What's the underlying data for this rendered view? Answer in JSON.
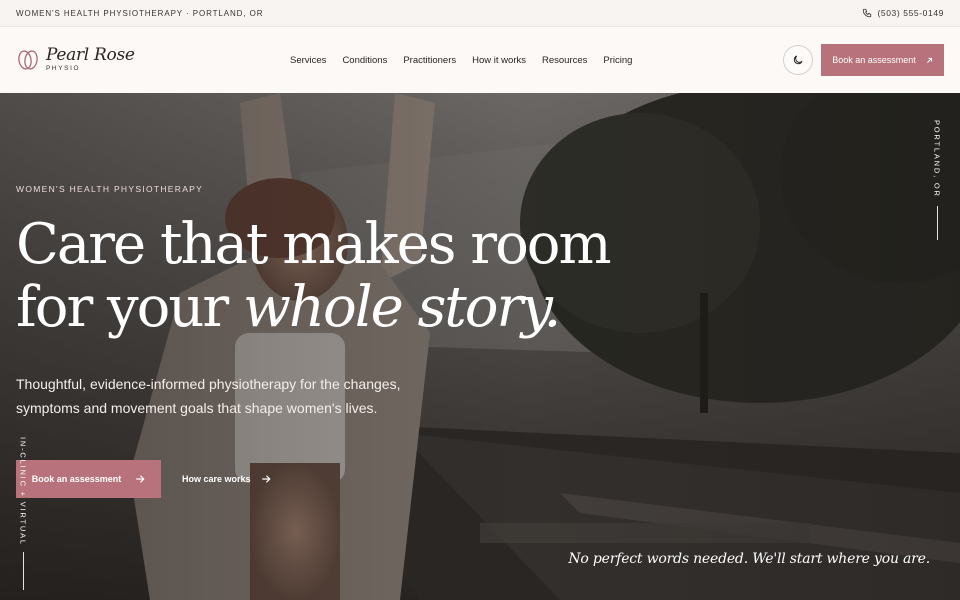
{
  "topbar": {
    "location": "WOMEN'S HEALTH PHYSIOTHERAPY · PORTLAND, OR",
    "phone": "(503) 555-0149",
    "phone_icon": "phone-icon"
  },
  "brand": {
    "name": "Pearl Rose",
    "sub": "PHYSIO",
    "logo_icon": "pearl-logo-icon"
  },
  "nav": {
    "items": [
      {
        "label": "Services"
      },
      {
        "label": "Conditions"
      },
      {
        "label": "Practitioners"
      },
      {
        "label": "How it works"
      },
      {
        "label": "Resources"
      },
      {
        "label": "Pricing"
      }
    ]
  },
  "header": {
    "theme_icon": "moon-icon",
    "cta_label": "Book an assessment",
    "cta_icon": "arrow-up-right-icon"
  },
  "hero": {
    "eyebrow": "WOMEN'S HEALTH PHYSIOTHERAPY",
    "headline_line1": "Care that makes room",
    "headline_line2_plain": "for your ",
    "headline_line2_italic": "whole story.",
    "lede": "Thoughtful, evidence-informed physiotherapy for the changes, symptoms and movement goals that shape women's lives.",
    "primary_label": "Book an assessment",
    "secondary_label": "How care works",
    "arrow_icon": "arrow-right-icon",
    "side_right": "PORTLAND, OR",
    "side_left": "IN-CLINIC + VIRTUAL",
    "quote": "No perfect words needed. We'll start where you are."
  },
  "colors": {
    "accent": "#b7727b",
    "eyebrow": "#f0d8dc",
    "topbar_bg": "#f8f4f1",
    "hero_overlay": "#1e1a18"
  }
}
